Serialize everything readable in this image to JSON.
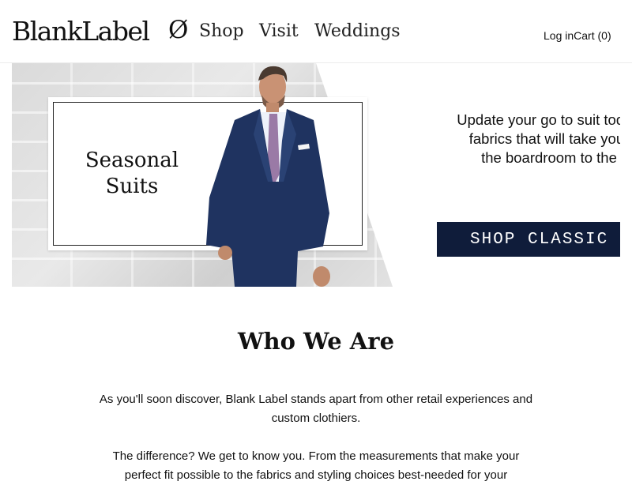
{
  "header": {
    "logo": "BlankLabel",
    "logo_mark": "Ø",
    "nav": [
      "Shop",
      "Visit",
      "Weddings"
    ],
    "login": "Log in",
    "cart": "Cart (0)"
  },
  "hero": {
    "title_line1": "Seasonal",
    "title_line2": "Suits"
  },
  "promo": {
    "line1": "Update your go to suit today with",
    "line2": "fabrics that will take you from",
    "line3": "the boardroom to the bar.",
    "button": "SHOP CLASSIC SUITS"
  },
  "about": {
    "title": "Who We Are",
    "p1": "As you'll soon discover, Blank Label stands apart from other retail experiences and custom clothiers.",
    "p2": "The difference? We get to know you. From the measurements that make your perfect fit possible to the fabrics and styling choices best-needed for your"
  },
  "colors": {
    "button_bg": "#0f1c3a",
    "suit": "#1f3360"
  }
}
